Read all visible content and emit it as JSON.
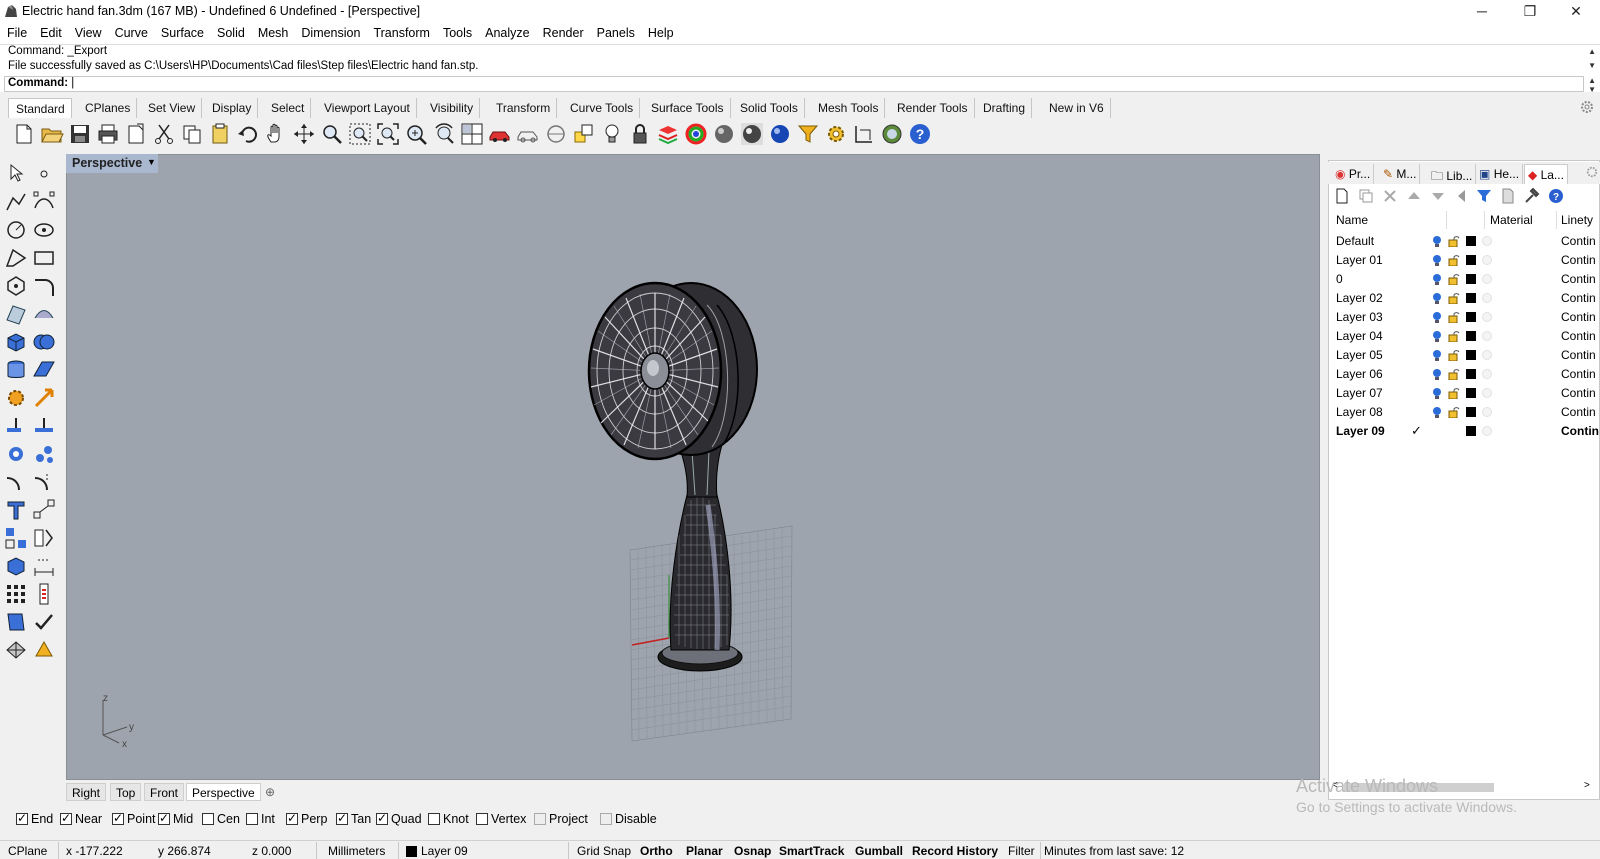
{
  "window": {
    "title": "Electric hand fan.3dm (167 MB) - Undefined 6 Undefined - [Perspective]",
    "minimize": "─",
    "restore": "❐",
    "close": "✕"
  },
  "menu": [
    "File",
    "Edit",
    "View",
    "Curve",
    "Surface",
    "Solid",
    "Mesh",
    "Dimension",
    "Transform",
    "Tools",
    "Analyze",
    "Render",
    "Panels",
    "Help"
  ],
  "command": {
    "history_line1": "Command: _Export",
    "history_line2": "File successfully saved as C:\\Users\\HP\\Documents\\Cad files\\Step files\\Electric hand fan.stp.",
    "prompt": "Command:"
  },
  "toolbar_tabs": [
    "Standard",
    "CPlanes",
    "Set View",
    "Display",
    "Select",
    "Viewport Layout",
    "Visibility",
    "Transform",
    "Curve Tools",
    "Surface Tools",
    "Solid Tools",
    "Mesh Tools",
    "Render Tools",
    "Drafting",
    "New in V6"
  ],
  "viewport": {
    "label": "Perspective",
    "axis_z": "z",
    "axis_y": "y",
    "axis_x": "x"
  },
  "viewport_tabs": [
    "Right",
    "Top",
    "Front",
    "Perspective"
  ],
  "viewport_add": "⊕",
  "panel": {
    "tabs": [
      "Pr...",
      "M...",
      "Lib...",
      "He...",
      "La..."
    ],
    "columns": {
      "name": "Name",
      "material": "Material",
      "linetype": "Linety"
    },
    "layers": [
      {
        "name": "Default",
        "linetype": "Contin"
      },
      {
        "name": "Layer 01",
        "linetype": "Contin"
      },
      {
        "name": "0",
        "linetype": "Contin"
      },
      {
        "name": "Layer 02",
        "linetype": "Contin"
      },
      {
        "name": "Layer 03",
        "linetype": "Contin"
      },
      {
        "name": "Layer 04",
        "linetype": "Contin"
      },
      {
        "name": "Layer 05",
        "linetype": "Contin"
      },
      {
        "name": "Layer 06",
        "linetype": "Contin"
      },
      {
        "name": "Layer 07",
        "linetype": "Contin"
      },
      {
        "name": "Layer 08",
        "linetype": "Contin"
      },
      {
        "name": "Layer 09",
        "linetype": "Contin",
        "current_mark": "✓"
      }
    ]
  },
  "osnaps": [
    {
      "label": "End",
      "checked": true
    },
    {
      "label": "Near",
      "checked": true
    },
    {
      "label": "Point",
      "checked": true
    },
    {
      "label": "Mid",
      "checked": true
    },
    {
      "label": "Cen",
      "checked": false
    },
    {
      "label": "Int",
      "checked": false
    },
    {
      "label": "Perp",
      "checked": true
    },
    {
      "label": "Tan",
      "checked": true
    },
    {
      "label": "Quad",
      "checked": true
    },
    {
      "label": "Knot",
      "checked": false
    },
    {
      "label": "Vertex",
      "checked": false
    },
    {
      "label": "Project",
      "checked": false
    },
    {
      "label": "Disable",
      "checked": false
    }
  ],
  "status": {
    "cplane": "CPlane",
    "x": "x -177.222",
    "y": "y 266.874",
    "z": "z 0.000",
    "units": "Millimeters",
    "layer": "Layer 09",
    "grid_snap": "Grid Snap",
    "ortho": "Ortho",
    "planar": "Planar",
    "osnap": "Osnap",
    "smarttrack": "SmartTrack",
    "gumball": "Gumball",
    "record_history": "Record History",
    "filter": "Filter",
    "last_save": "Minutes from last save: 12"
  },
  "watermark": {
    "line1": "Activate Windows",
    "line2": "Go to Settings to activate Windows."
  }
}
